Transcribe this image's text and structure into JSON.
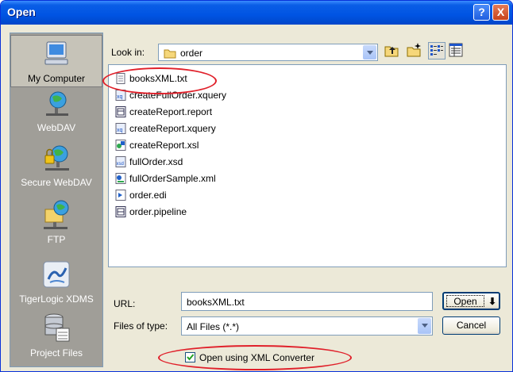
{
  "window": {
    "title": "Open",
    "help_label": "?",
    "close_label": "X"
  },
  "places": [
    {
      "label": "My Computer",
      "icon": "my-computer-icon"
    },
    {
      "label": "WebDAV",
      "icon": "webdav-icon"
    },
    {
      "label": "Secure WebDAV",
      "icon": "secure-webdav-icon"
    },
    {
      "label": "FTP",
      "icon": "ftp-icon"
    },
    {
      "label": "TigerLogic XDMS",
      "icon": "tigerlogic-xdms-icon"
    },
    {
      "label": "Project Files",
      "icon": "project-files-icon"
    }
  ],
  "lookin": {
    "label": "Look in:",
    "value": "order"
  },
  "files": [
    {
      "name": "booksXML.txt",
      "icon": "text-file-icon"
    },
    {
      "name": "createFullOrder.xquery",
      "icon": "xquery-file-icon"
    },
    {
      "name": "createReport.report",
      "icon": "report-file-icon"
    },
    {
      "name": "createReport.xquery",
      "icon": "xquery-file-icon"
    },
    {
      "name": "createReport.xsl",
      "icon": "xsl-file-icon"
    },
    {
      "name": "fullOrder.xsd",
      "icon": "xsd-file-icon"
    },
    {
      "name": "fullOrderSample.xml",
      "icon": "xml-file-icon"
    },
    {
      "name": "order.edi",
      "icon": "edi-file-icon"
    },
    {
      "name": "order.pipeline",
      "icon": "pipeline-file-icon"
    }
  ],
  "url": {
    "label": "URL:",
    "value": "booksXML.txt"
  },
  "filetype": {
    "label": "Files of type:",
    "value": "All Files (*.*)"
  },
  "buttons": {
    "open": "Open",
    "cancel": "Cancel"
  },
  "option": {
    "label": "Open using XML Converter",
    "checked": true
  },
  "colors": {
    "highlight_ellipse": "#e0202a",
    "titlebar": "#0054e3"
  }
}
